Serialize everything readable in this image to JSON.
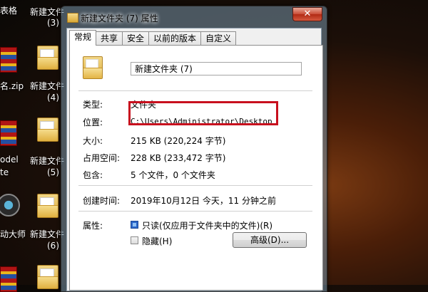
{
  "desktop": {
    "icons": [
      {
        "label": "表格",
        "sub": ""
      },
      {
        "label": "新建文件",
        "sub": "(3)"
      },
      {
        "label": "名.zip",
        "sub": ""
      },
      {
        "label": "新建文件",
        "sub": "(4)"
      },
      {
        "label": "odel",
        "sub": "te"
      },
      {
        "label": "新建文件",
        "sub": "(5)"
      },
      {
        "label": "动大师",
        "sub": ""
      },
      {
        "label": "新建文件",
        "sub": "(6)"
      }
    ]
  },
  "window": {
    "title": "新建文件夹 (7) 属性",
    "close_glyph": "✕",
    "tabs": [
      "常规",
      "共享",
      "安全",
      "以前的版本",
      "自定义"
    ],
    "active_tab": 0,
    "folder_name": "新建文件夹 (7)",
    "fields": [
      {
        "key": "类型:",
        "value": "文件夹"
      },
      {
        "key": "位置:",
        "value": "C:\\Users\\Administrator\\Desktop"
      },
      {
        "key": "大小:",
        "value": "215 KB (220,224 字节)"
      },
      {
        "key": "占用空间:",
        "value": "228 KB (233,472 字节)"
      },
      {
        "key": "包含:",
        "value": "5 个文件，0 个文件夹"
      }
    ],
    "created": {
      "key": "创建时间:",
      "value": "2019年10月12日 今天，11 分钟之前"
    },
    "attributes": {
      "key": "属性:",
      "readonly_label": "只读(仅应用于文件夹中的文件)(R)",
      "readonly_checked": true,
      "hidden_label": "隐藏(H)",
      "hidden_checked": false,
      "advanced_button": "高级(D)..."
    }
  },
  "colors": {
    "highlight": "#c8101e",
    "checkbox_checked": "#2a66c8"
  }
}
